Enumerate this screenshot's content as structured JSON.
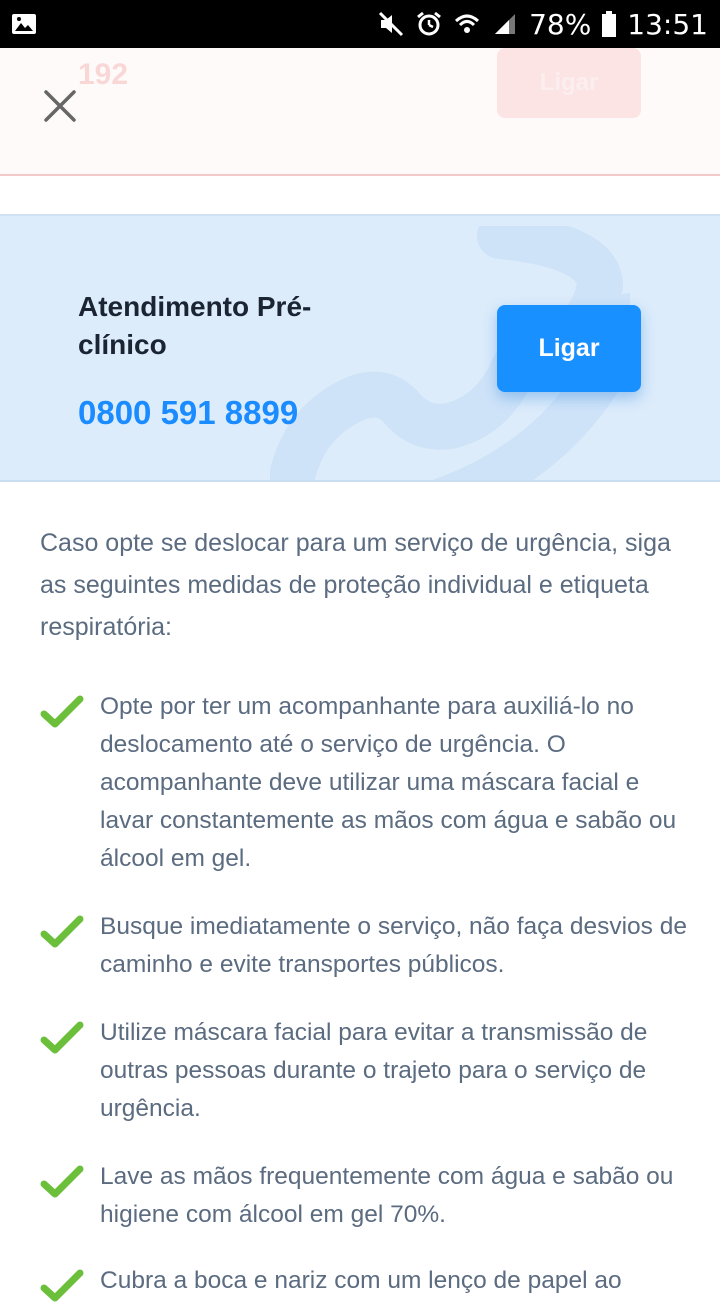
{
  "status_bar": {
    "battery": "78%",
    "time": "13:51"
  },
  "emergency_card": {
    "number": "192",
    "call_label": "Ligar"
  },
  "preclinic_card": {
    "title": "Atendimento Pré-clínico",
    "number": "0800 591 8899",
    "call_label": "Ligar"
  },
  "intro_text": "Caso opte se deslocar para um serviço de urgência, siga as seguintes medidas de proteção individual e etiqueta respiratória:",
  "measures": [
    "Opte por ter um acompanhante para auxiliá-lo no deslocamento até o serviço de urgência. O acompanhante deve utilizar uma máscara facial e lavar constantemente as mãos com água e sabão ou álcool em gel.",
    "Busque imediatamente o serviço, não faça desvios de caminho e evite transportes públicos.",
    "Utilize máscara facial para evitar a transmissão de outras pessoas durante o trajeto para o serviço de urgência.",
    "Lave as mãos frequentemente com água e sabão ou higiene com álcool em gel 70%.",
    "Cubra a boca e nariz com um lenço de papel ao"
  ],
  "colors": {
    "accent_blue": "#1890ff",
    "card_blue_bg": "#dcecfb",
    "check_green": "#6bbf3b",
    "body_text": "#5b6b80"
  }
}
